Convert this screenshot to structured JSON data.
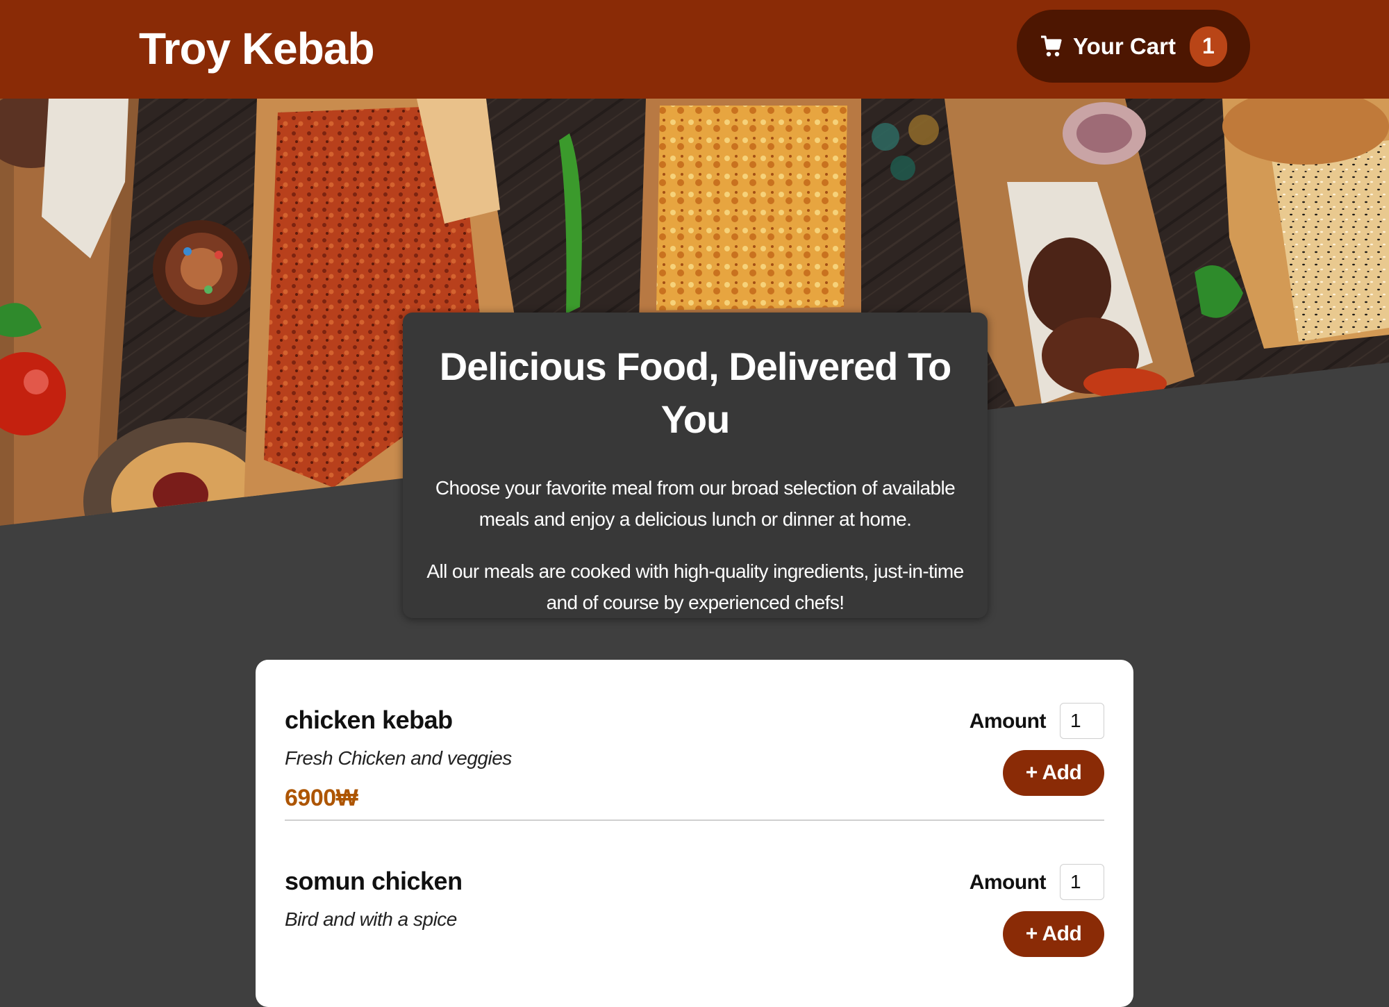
{
  "header": {
    "title": "Troy Kebab",
    "cart_label": "Your Cart",
    "cart_count": "1",
    "cart_icon": "cart-icon"
  },
  "summary": {
    "heading": "Delicious Food, Delivered To You",
    "paragraph_1": "Choose your favorite meal from our broad selection of available meals and enjoy a delicious lunch or dinner at home.",
    "paragraph_2": "All our meals are cooked with high-quality ingredients, just-in-time and of course by experienced chefs!"
  },
  "meals": [
    {
      "name": "chicken kebab",
      "description": "Fresh Chicken and veggies",
      "price": "6900₩",
      "amount_label": "Amount",
      "amount_value": "1",
      "add_label": "+ Add"
    },
    {
      "name": "somun chicken",
      "description": "Bird and with a spice",
      "price": "",
      "amount_label": "Amount",
      "amount_value": "1",
      "add_label": "+ Add"
    }
  ],
  "colors": {
    "header_bg": "#8a2b06",
    "cart_bg": "#4d1601",
    "badge_bg": "#b94517",
    "page_bg": "#3f3f3f",
    "price": "#ad5502"
  }
}
